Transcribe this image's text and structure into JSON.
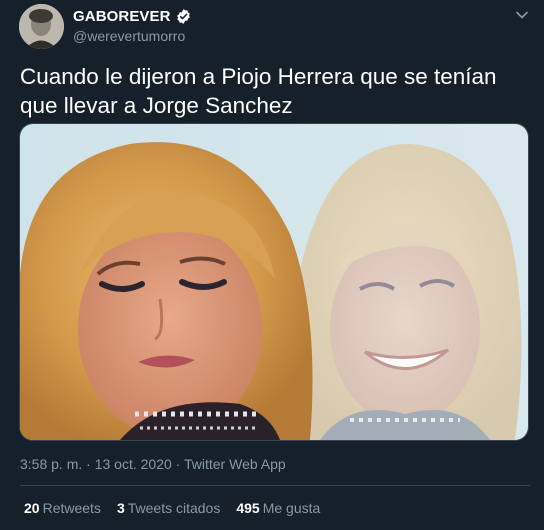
{
  "author": {
    "display_name": "GABOREVER",
    "handle": "@werevertumorro",
    "verified_icon": "verified-badge-icon",
    "verified_color": "#ffffff"
  },
  "tweet": {
    "text": "Cuando le dijeron a Piojo Herrera que se tenían que llevar a Jorge Sanchez"
  },
  "media": {
    "icon": "photo"
  },
  "meta": {
    "time": "3:58 p. m.",
    "separator": "·",
    "date": "13 oct. 2020",
    "source": "Twitter Web App"
  },
  "stats": {
    "retweets_count": "20",
    "retweets_label": "Retweets",
    "quotes_count": "3",
    "quotes_label": "Tweets citados",
    "likes_count": "495",
    "likes_label": "Me gusta"
  },
  "colors": {
    "background": "#15202b",
    "secondary_text": "#8899a6",
    "border": "#38444d"
  }
}
